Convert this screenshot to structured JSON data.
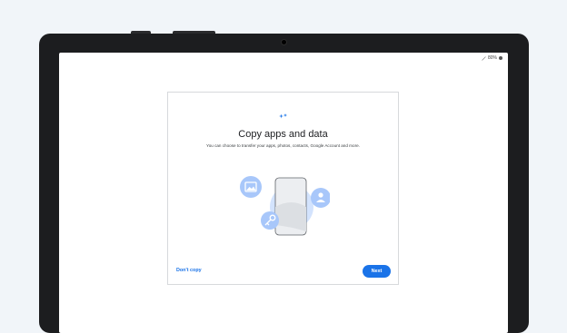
{
  "status_bar": {
    "battery": "80%",
    "icons": [
      "signal-icon",
      "battery-icon"
    ]
  },
  "dialog": {
    "icon": "sparkle-transfer-icon",
    "title": "Copy apps and data",
    "subtitle": "You can choose to transfer your apps, photos, contacts, Google Account and more.",
    "illustration_icons": [
      "image-icon",
      "person-icon",
      "key-icon",
      "phone-icon"
    ],
    "dont_copy_label": "Don't copy",
    "next_label": "Next"
  },
  "colors": {
    "accent": "#1a73e8",
    "illustration_blue": "#a8c7fa",
    "illustration_light": "#d3e3fd",
    "phone_gray": "#e8eaed",
    "background": "#f1f5f9",
    "bezel": "#1c1d1f"
  }
}
